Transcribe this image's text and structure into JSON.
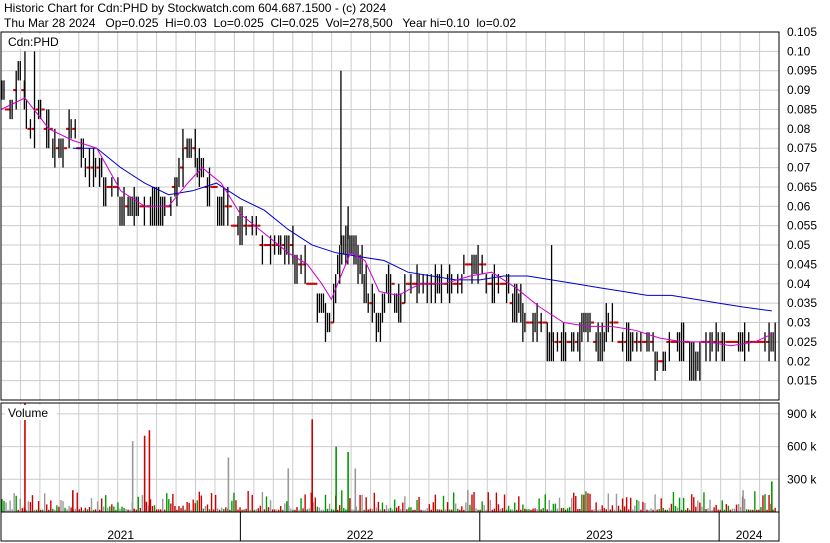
{
  "header": {
    "line1": "Historic Chart for Cdn:PHD by Stockwatch.com 604.687.1500 - (c) 2024",
    "line2": "Thu Mar 28 2024   Op=0.025  Hi=0.03  Lo=0.025  Cl=0.025  Vol=278,500   Year hi=0.10  lo=0.02"
  },
  "colors": {
    "price_bar": "#000000",
    "flat_tick": "#cc0000",
    "ma_short": "#cc00cc",
    "ma_long": "#0000cc",
    "vol_up": "#009900",
    "vol_down": "#cc0000",
    "vol_flat": "#999999",
    "grid": "#cccccc"
  },
  "chart_data": [
    {
      "type": "line",
      "panel": "price",
      "label": "Cdn:PHD",
      "ylim": [
        0.01,
        0.105
      ],
      "y_ticks": [
        "0.105",
        "0.10",
        "0.095",
        "0.09",
        "0.085",
        "0.08",
        "0.075",
        "0.07",
        "0.065",
        "0.06",
        "0.055",
        "0.05",
        "0.045",
        "0.04",
        "0.035",
        "0.03",
        "0.025",
        "0.02",
        "0.015"
      ],
      "y_tick_values": [
        0.105,
        0.1,
        0.095,
        0.09,
        0.085,
        0.08,
        0.075,
        0.07,
        0.065,
        0.06,
        0.055,
        0.05,
        0.045,
        0.04,
        0.035,
        0.03,
        0.025,
        0.02,
        0.015
      ],
      "x_ticks": [
        "2021",
        "2022",
        "2023",
        "2024"
      ],
      "x_range": [
        2021.0,
        2024.25
      ],
      "x_year_starts": [
        2021.0,
        2022.0,
        2023.0,
        2024.0
      ],
      "price_points": [
        [
          2021.0,
          0.09
        ],
        [
          2021.04,
          0.085
        ],
        [
          2021.08,
          0.095
        ],
        [
          2021.12,
          0.08
        ],
        [
          2021.16,
          0.085
        ],
        [
          2021.2,
          0.078
        ],
        [
          2021.25,
          0.075
        ],
        [
          2021.3,
          0.08
        ],
        [
          2021.35,
          0.072
        ],
        [
          2021.4,
          0.07
        ],
        [
          2021.45,
          0.065
        ],
        [
          2021.5,
          0.062
        ],
        [
          2021.55,
          0.06
        ],
        [
          2021.6,
          0.06
        ],
        [
          2021.65,
          0.062
        ],
        [
          2021.7,
          0.06
        ],
        [
          2021.76,
          0.072
        ],
        [
          2021.8,
          0.075
        ],
        [
          2021.84,
          0.068
        ],
        [
          2021.88,
          0.065
        ],
        [
          2021.92,
          0.06
        ],
        [
          2022.0,
          0.055
        ],
        [
          2022.05,
          0.055
        ],
        [
          2022.1,
          0.05
        ],
        [
          2022.15,
          0.052
        ],
        [
          2022.2,
          0.05
        ],
        [
          2022.25,
          0.045
        ],
        [
          2022.3,
          0.04
        ],
        [
          2022.34,
          0.035
        ],
        [
          2022.38,
          0.028
        ],
        [
          2022.42,
          0.05
        ],
        [
          2022.46,
          0.052
        ],
        [
          2022.5,
          0.045
        ],
        [
          2022.54,
          0.035
        ],
        [
          2022.58,
          0.03
        ],
        [
          2022.62,
          0.04
        ],
        [
          2022.66,
          0.035
        ],
        [
          2022.7,
          0.04
        ],
        [
          2022.75,
          0.04
        ],
        [
          2022.8,
          0.042
        ],
        [
          2022.85,
          0.04
        ],
        [
          2022.9,
          0.04
        ],
        [
          2022.96,
          0.045
        ],
        [
          2023.0,
          0.045
        ],
        [
          2023.05,
          0.04
        ],
        [
          2023.1,
          0.04
        ],
        [
          2023.15,
          0.035
        ],
        [
          2023.2,
          0.03
        ],
        [
          2023.25,
          0.03
        ],
        [
          2023.3,
          0.025
        ],
        [
          2023.35,
          0.025
        ],
        [
          2023.4,
          0.025
        ],
        [
          2023.45,
          0.03
        ],
        [
          2023.5,
          0.025
        ],
        [
          2023.55,
          0.03
        ],
        [
          2023.6,
          0.025
        ],
        [
          2023.65,
          0.025
        ],
        [
          2023.7,
          0.025
        ],
        [
          2023.75,
          0.02
        ],
        [
          2023.8,
          0.025
        ],
        [
          2023.85,
          0.025
        ],
        [
          2023.9,
          0.02
        ],
        [
          2023.95,
          0.025
        ],
        [
          2024.0,
          0.025
        ],
        [
          2024.05,
          0.025
        ],
        [
          2024.1,
          0.025
        ],
        [
          2024.2,
          0.025
        ]
      ],
      "spikes": [
        [
          2021.1,
          0.1
        ],
        [
          2021.14,
          0.1
        ],
        [
          2021.76,
          0.08
        ],
        [
          2022.42,
          0.095
        ],
        [
          2022.45,
          0.06
        ],
        [
          2023.3,
          0.05
        ]
      ],
      "ma_short": [
        [
          2021.0,
          0.085
        ],
        [
          2021.1,
          0.088
        ],
        [
          2021.2,
          0.08
        ],
        [
          2021.3,
          0.077
        ],
        [
          2021.4,
          0.075
        ],
        [
          2021.5,
          0.064
        ],
        [
          2021.6,
          0.06
        ],
        [
          2021.7,
          0.06
        ],
        [
          2021.78,
          0.066
        ],
        [
          2021.84,
          0.07
        ],
        [
          2021.92,
          0.066
        ],
        [
          2022.0,
          0.058
        ],
        [
          2022.1,
          0.053
        ],
        [
          2022.2,
          0.048
        ],
        [
          2022.28,
          0.045
        ],
        [
          2022.34,
          0.04
        ],
        [
          2022.38,
          0.036
        ],
        [
          2022.42,
          0.042
        ],
        [
          2022.46,
          0.048
        ],
        [
          2022.52,
          0.046
        ],
        [
          2022.58,
          0.038
        ],
        [
          2022.66,
          0.037
        ],
        [
          2022.75,
          0.04
        ],
        [
          2022.85,
          0.04
        ],
        [
          2022.96,
          0.042
        ],
        [
          2023.05,
          0.043
        ],
        [
          2023.15,
          0.039
        ],
        [
          2023.25,
          0.034
        ],
        [
          2023.35,
          0.03
        ],
        [
          2023.45,
          0.029
        ],
        [
          2023.55,
          0.029
        ],
        [
          2023.65,
          0.028
        ],
        [
          2023.75,
          0.026
        ],
        [
          2023.85,
          0.025
        ],
        [
          2023.95,
          0.025
        ],
        [
          2024.05,
          0.024
        ],
        [
          2024.15,
          0.025
        ],
        [
          2024.22,
          0.027
        ]
      ],
      "ma_long": [
        [
          2021.3,
          0.075
        ],
        [
          2021.4,
          0.075
        ],
        [
          2021.5,
          0.07
        ],
        [
          2021.6,
          0.066
        ],
        [
          2021.7,
          0.063
        ],
        [
          2021.8,
          0.064
        ],
        [
          2021.9,
          0.066
        ],
        [
          2022.0,
          0.062
        ],
        [
          2022.1,
          0.059
        ],
        [
          2022.2,
          0.054
        ],
        [
          2022.3,
          0.05
        ],
        [
          2022.4,
          0.048
        ],
        [
          2022.5,
          0.047
        ],
        [
          2022.6,
          0.046
        ],
        [
          2022.7,
          0.043
        ],
        [
          2022.8,
          0.042
        ],
        [
          2022.9,
          0.041
        ],
        [
          2023.0,
          0.041
        ],
        [
          2023.1,
          0.042
        ],
        [
          2023.2,
          0.042
        ],
        [
          2023.3,
          0.041
        ],
        [
          2023.4,
          0.04
        ],
        [
          2023.5,
          0.039
        ],
        [
          2023.6,
          0.038
        ],
        [
          2023.7,
          0.037
        ],
        [
          2023.8,
          0.037
        ],
        [
          2023.9,
          0.036
        ],
        [
          2024.0,
          0.035
        ],
        [
          2024.1,
          0.034
        ],
        [
          2024.22,
          0.033
        ]
      ]
    },
    {
      "type": "bar",
      "panel": "volume",
      "label": "Volume",
      "ylim": [
        0,
        1000000
      ],
      "y_ticks": [
        "900 k",
        "600 k",
        "300 k"
      ],
      "y_tick_values": [
        900000,
        600000,
        300000
      ],
      "volume_spikes": [
        [
          2021.1,
          1000000,
          "down"
        ],
        [
          2021.3,
          200000,
          "down"
        ],
        [
          2021.55,
          650000,
          "flat"
        ],
        [
          2021.6,
          700000,
          "down"
        ],
        [
          2021.62,
          750000,
          "down"
        ],
        [
          2021.95,
          500000,
          "flat"
        ],
        [
          2022.2,
          400000,
          "flat"
        ],
        [
          2022.3,
          850000,
          "down"
        ],
        [
          2022.4,
          600000,
          "up"
        ],
        [
          2022.45,
          550000,
          "up"
        ],
        [
          2022.48,
          400000,
          "flat"
        ],
        [
          2022.95,
          200000,
          "flat"
        ],
        [
          2024.1,
          200000,
          "flat"
        ],
        [
          2024.22,
          280000,
          "up"
        ]
      ]
    }
  ]
}
